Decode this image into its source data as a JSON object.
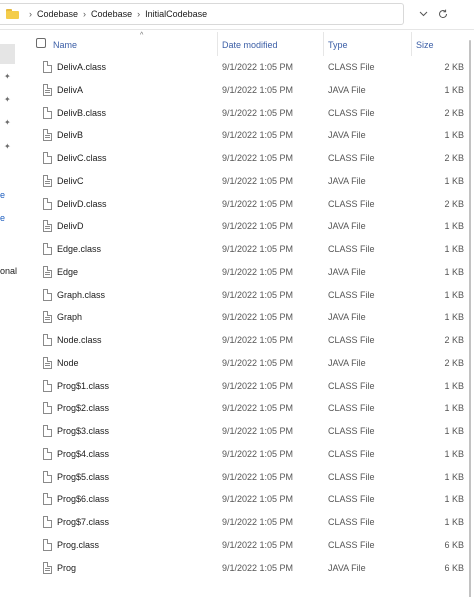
{
  "address_bar": {
    "crumbs": [
      "Codebase",
      "Codebase",
      "InitialCodebase"
    ],
    "dropdown_icon": "chevron-down-icon",
    "refresh_icon": "refresh-icon"
  },
  "nav_fragments": [
    "e",
    "e",
    "onal"
  ],
  "columns": {
    "name": "Name",
    "date": "Date modified",
    "type": "Type",
    "size": "Size"
  },
  "files": [
    {
      "name": "DelivA.class",
      "date": "9/1/2022 1:05 PM",
      "type": "CLASS File",
      "size": "2 KB",
      "icon": "class-file-icon"
    },
    {
      "name": "DelivA",
      "date": "9/1/2022 1:05 PM",
      "type": "JAVA File",
      "size": "1 KB",
      "icon": "java-file-icon"
    },
    {
      "name": "DelivB.class",
      "date": "9/1/2022 1:05 PM",
      "type": "CLASS File",
      "size": "2 KB",
      "icon": "class-file-icon"
    },
    {
      "name": "DelivB",
      "date": "9/1/2022 1:05 PM",
      "type": "JAVA File",
      "size": "1 KB",
      "icon": "java-file-icon"
    },
    {
      "name": "DelivC.class",
      "date": "9/1/2022 1:05 PM",
      "type": "CLASS File",
      "size": "2 KB",
      "icon": "class-file-icon"
    },
    {
      "name": "DelivC",
      "date": "9/1/2022 1:05 PM",
      "type": "JAVA File",
      "size": "1 KB",
      "icon": "java-file-icon"
    },
    {
      "name": "DelivD.class",
      "date": "9/1/2022 1:05 PM",
      "type": "CLASS File",
      "size": "2 KB",
      "icon": "class-file-icon"
    },
    {
      "name": "DelivD",
      "date": "9/1/2022 1:05 PM",
      "type": "JAVA File",
      "size": "1 KB",
      "icon": "java-file-icon"
    },
    {
      "name": "Edge.class",
      "date": "9/1/2022 1:05 PM",
      "type": "CLASS File",
      "size": "1 KB",
      "icon": "class-file-icon"
    },
    {
      "name": "Edge",
      "date": "9/1/2022 1:05 PM",
      "type": "JAVA File",
      "size": "1 KB",
      "icon": "java-file-icon"
    },
    {
      "name": "Graph.class",
      "date": "9/1/2022 1:05 PM",
      "type": "CLASS File",
      "size": "1 KB",
      "icon": "class-file-icon"
    },
    {
      "name": "Graph",
      "date": "9/1/2022 1:05 PM",
      "type": "JAVA File",
      "size": "1 KB",
      "icon": "java-file-icon"
    },
    {
      "name": "Node.class",
      "date": "9/1/2022 1:05 PM",
      "type": "CLASS File",
      "size": "2 KB",
      "icon": "class-file-icon"
    },
    {
      "name": "Node",
      "date": "9/1/2022 1:05 PM",
      "type": "JAVA File",
      "size": "2 KB",
      "icon": "java-file-icon"
    },
    {
      "name": "Prog$1.class",
      "date": "9/1/2022 1:05 PM",
      "type": "CLASS File",
      "size": "1 KB",
      "icon": "class-file-icon"
    },
    {
      "name": "Prog$2.class",
      "date": "9/1/2022 1:05 PM",
      "type": "CLASS File",
      "size": "1 KB",
      "icon": "class-file-icon"
    },
    {
      "name": "Prog$3.class",
      "date": "9/1/2022 1:05 PM",
      "type": "CLASS File",
      "size": "1 KB",
      "icon": "class-file-icon"
    },
    {
      "name": "Prog$4.class",
      "date": "9/1/2022 1:05 PM",
      "type": "CLASS File",
      "size": "1 KB",
      "icon": "class-file-icon"
    },
    {
      "name": "Prog$5.class",
      "date": "9/1/2022 1:05 PM",
      "type": "CLASS File",
      "size": "1 KB",
      "icon": "class-file-icon"
    },
    {
      "name": "Prog$6.class",
      "date": "9/1/2022 1:05 PM",
      "type": "CLASS File",
      "size": "1 KB",
      "icon": "class-file-icon"
    },
    {
      "name": "Prog$7.class",
      "date": "9/1/2022 1:05 PM",
      "type": "CLASS File",
      "size": "1 KB",
      "icon": "class-file-icon"
    },
    {
      "name": "Prog.class",
      "date": "9/1/2022 1:05 PM",
      "type": "CLASS File",
      "size": "6 KB",
      "icon": "class-file-icon"
    },
    {
      "name": "Prog",
      "date": "9/1/2022 1:05 PM",
      "type": "JAVA File",
      "size": "6 KB",
      "icon": "java-file-icon"
    }
  ],
  "colors": {
    "header_text": "#3b5ea6",
    "folder": "#f4cd4b"
  }
}
